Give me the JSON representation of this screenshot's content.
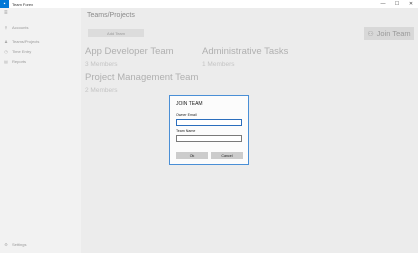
{
  "window": {
    "app_title": "Team Forex",
    "app_icon": "app-icon",
    "controls": {
      "minimize": "—",
      "maximize": "☐",
      "close": "✕"
    }
  },
  "sidebar": {
    "menu_icon": "≡",
    "items": [
      {
        "label": "Accounts",
        "icon": "⚲"
      },
      {
        "label": "Teams/Projects",
        "icon": "♟"
      },
      {
        "label": "Time Entry",
        "icon": "◷"
      },
      {
        "label": "Reports",
        "icon": "▤"
      }
    ],
    "settings": {
      "label": "Settings",
      "icon": "⚙"
    }
  },
  "main": {
    "page_title": "Teams/Projects",
    "add_team_label": "Add Team",
    "join_team_label": "Join Team",
    "join_team_icon": "⚇",
    "teams": [
      {
        "name": "App Developer Team",
        "members": "3 Members"
      },
      {
        "name": "Administrative Tasks",
        "members": "1 Members"
      },
      {
        "name": "Project Management Team",
        "members": "2 Members"
      }
    ]
  },
  "dialog": {
    "title": "JOIN TEAM",
    "owner_email_label": "Owner Email",
    "owner_email_value": "",
    "team_name_label": "Team Name",
    "team_name_value": "",
    "ok_label": "Ok",
    "cancel_label": "Cancel"
  },
  "colors": {
    "accent": "#0078d7",
    "dialog_border": "#4a8fd6",
    "background": "#ececec",
    "sidebar": "#f2f2f2"
  }
}
